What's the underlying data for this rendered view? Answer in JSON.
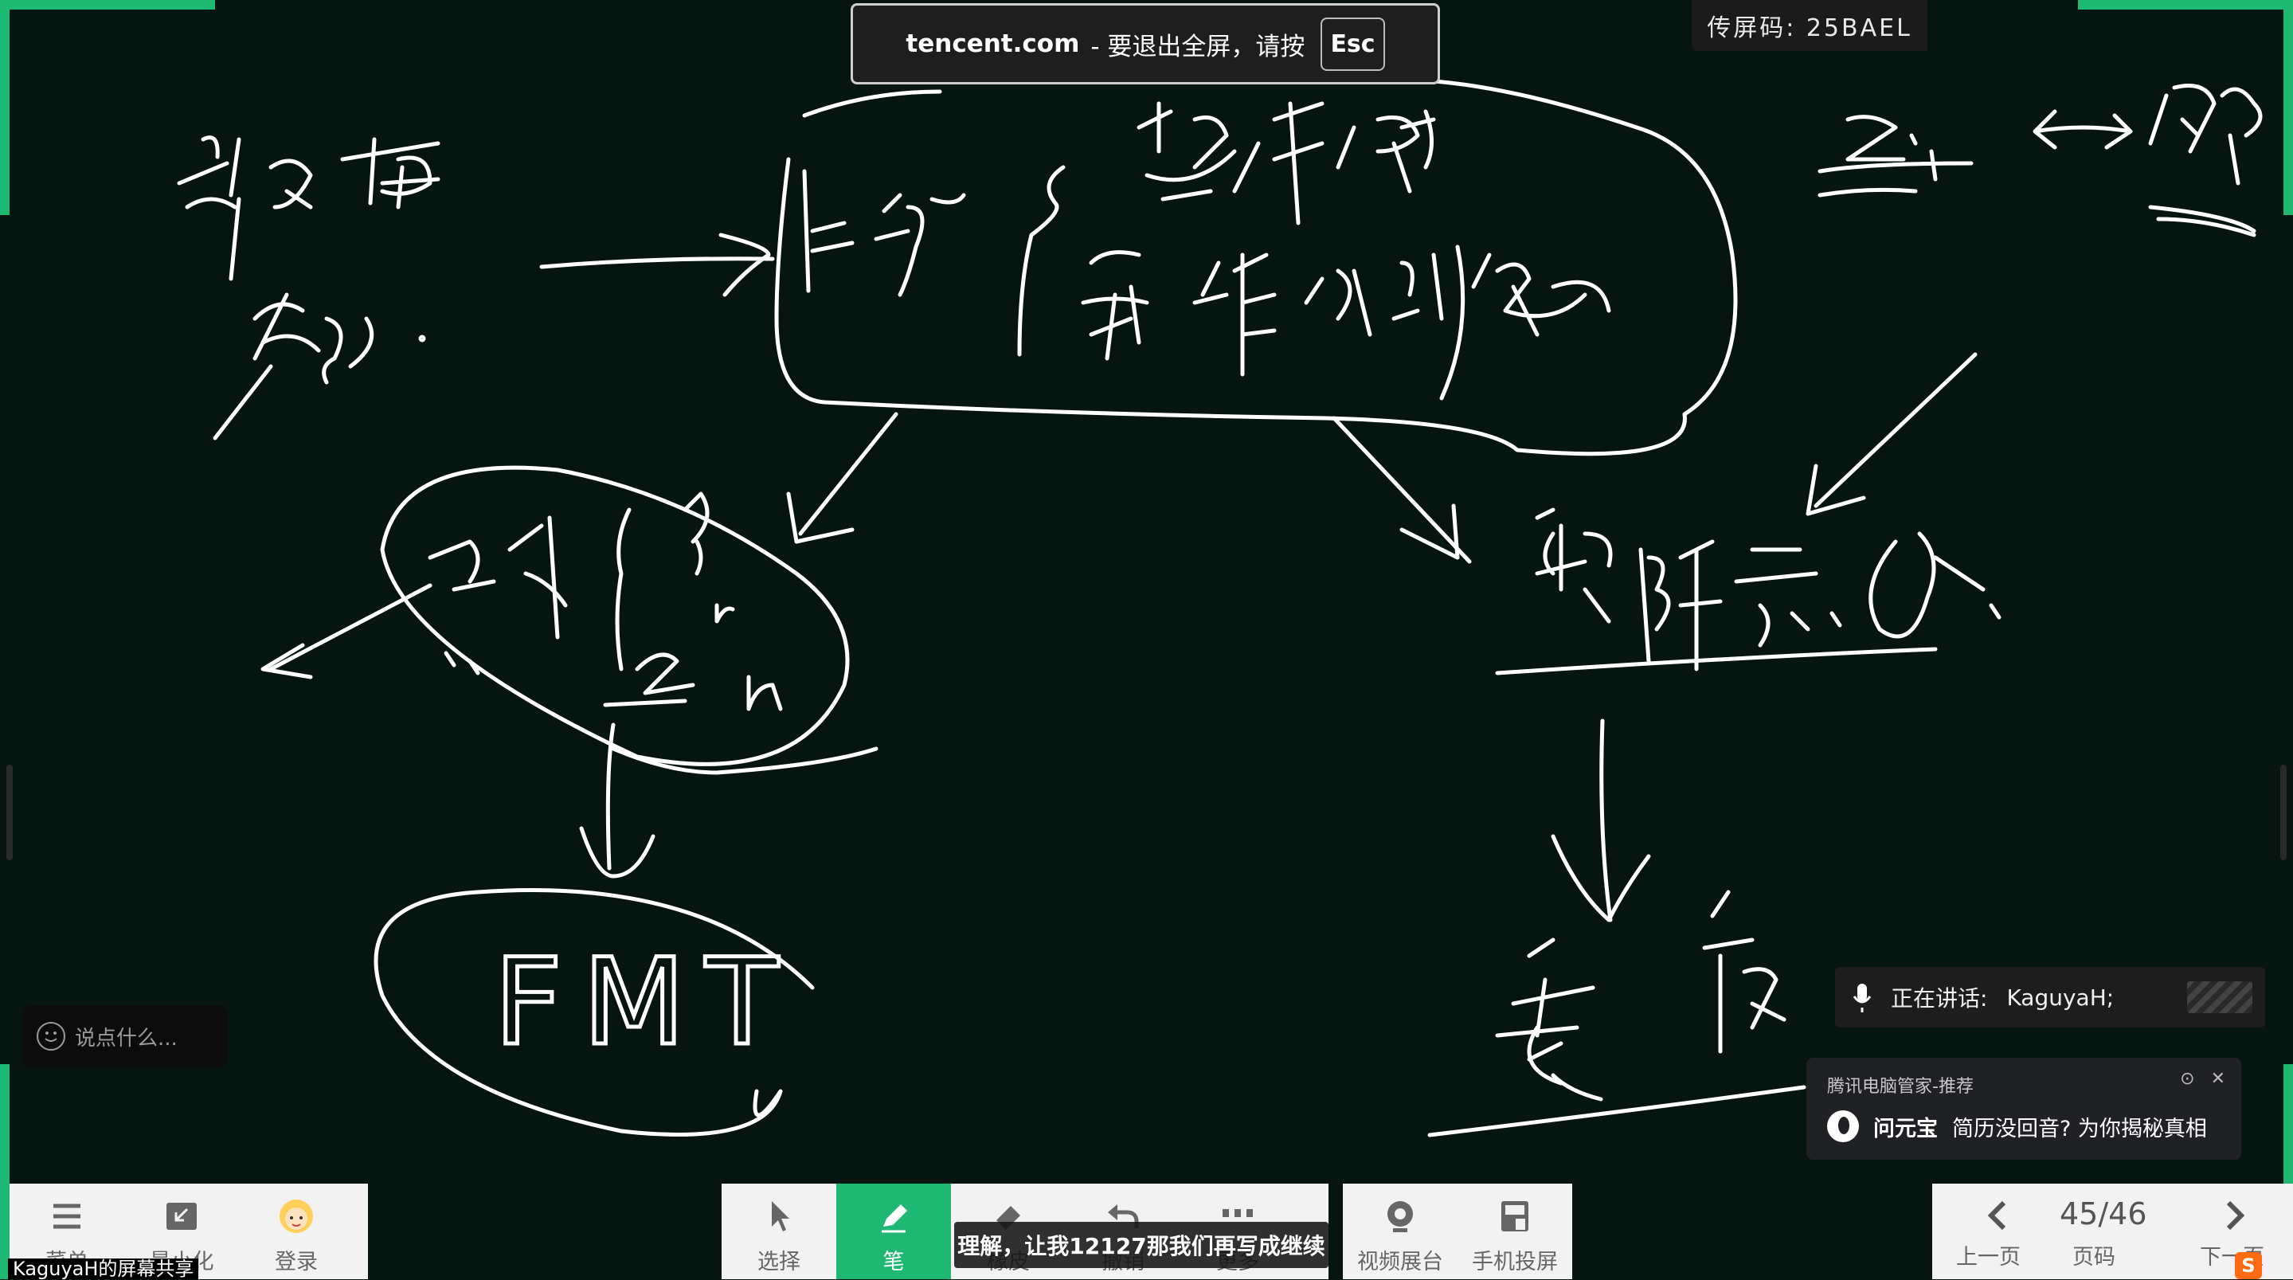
{
  "fullscreen_notice": {
    "host": "tencent.com",
    "message": "- 要退出全屏，请按",
    "key": "Esc"
  },
  "share_code": "传屏码: 25BAEL",
  "chat": {
    "placeholder": "说点什么..."
  },
  "speaking": {
    "label": "正在讲话:",
    "speaker": "KaguyaH;"
  },
  "popup": {
    "title": "腾讯电脑管家-推荐",
    "brand": "问元宝",
    "message": "简历没回音? 为你揭秘真相"
  },
  "left_toolbar": [
    {
      "label": "菜单",
      "icon": "menu-icon"
    },
    {
      "label": "最小化",
      "icon": "minimize-icon"
    },
    {
      "label": "登录",
      "icon": "avatar-icon"
    }
  ],
  "center_toolbar": [
    {
      "label": "选择",
      "icon": "cursor-icon"
    },
    {
      "label": "笔",
      "icon": "pen-icon",
      "active": true
    },
    {
      "label": "橡皮",
      "icon": "eraser-icon"
    },
    {
      "label": "撤销",
      "icon": "undo-icon"
    },
    {
      "label": "更多",
      "icon": "more-icon"
    }
  ],
  "media_toolbar": [
    {
      "label": "视频展台",
      "icon": "camera-icon"
    },
    {
      "label": "手机投屏",
      "icon": "phone-cast-icon"
    }
  ],
  "caption": "理解，让我12127那我们再写成继续",
  "pager": {
    "current": "45/46",
    "prev_label": "上一页",
    "page_label": "页码",
    "next_label": "下一页"
  },
  "share_label": "KaguyaH的屏幕共享",
  "handwriting": {
    "fmt": "FMT",
    "z": "Z",
    "n": "n",
    "colors": {
      "ink": "#ffffff",
      "board": "#061510",
      "accent": "#1fb873"
    }
  }
}
